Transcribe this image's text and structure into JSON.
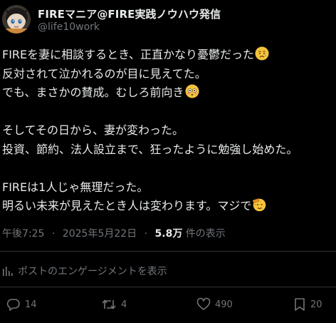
{
  "author": {
    "display_name": "FIREマニア@FIRE実践ノウハウ発信",
    "handle": "@life10work",
    "avatar_icon": "anime-character-avatar"
  },
  "tweet": {
    "lines": [
      "FIREを妻に相談するとき、正直かなり憂鬱だった",
      "反対されて泣かれるのが目に見えてた。",
      "でも、まさかの賛成。むしろ前向き",
      "",
      "そしてその日から、妻が変わった。",
      "投資、節約、法人設立まで、狂ったように勉強し始めた。",
      "",
      "FIREは1人じゃ無理だった。",
      "明るい未来が見えたとき人は変わります。マジで"
    ],
    "emojis": {
      "line1": "sad-relieved-face-emoji",
      "line3": "flushed-face-emoji",
      "line9": "saluting-face-emoji"
    }
  },
  "meta": {
    "time": "午後7:25",
    "date": "2025年5月22日",
    "views_count": "5.8万",
    "views_label": "件の表示",
    "separator": "·"
  },
  "engagements_link": "ポストのエンゲージメントを表示",
  "actions": {
    "reply_count": "14",
    "repost_count": "4",
    "like_count": "490",
    "bookmark_count": "20"
  },
  "colors": {
    "background": "#000000",
    "text": "#e7e9ea",
    "secondary": "#71767b",
    "divider": "#2f3336"
  }
}
